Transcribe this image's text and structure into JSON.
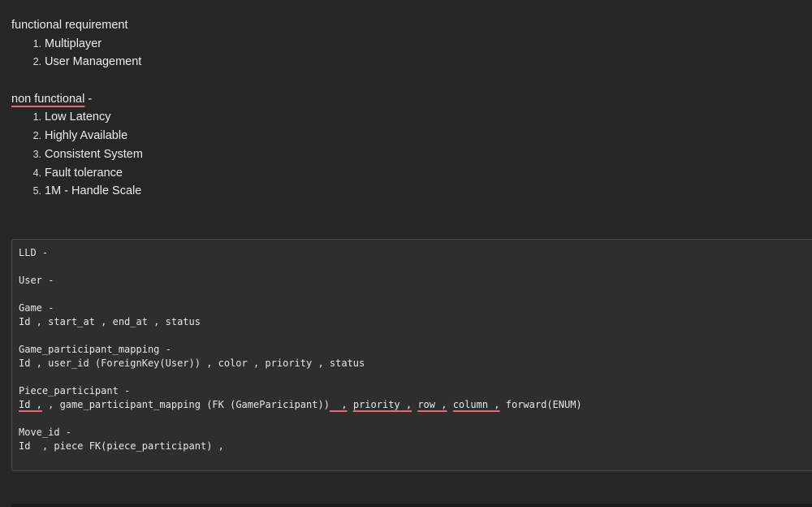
{
  "functional": {
    "heading": "functional requirement",
    "items": [
      "Multiplayer",
      "User Management"
    ]
  },
  "non_functional": {
    "heading_word": "non functional",
    "heading_suffix": " -",
    "items": [
      "Low Latency",
      "Highly Available",
      "Consistent System",
      "Fault tolerance",
      "1M - Handle Scale"
    ]
  },
  "numbers": [
    "1.",
    "2.",
    "3.",
    "4.",
    "5."
  ],
  "code": {
    "lld": "LLD -",
    "user": "User -",
    "game": "Game -",
    "game_fields": "Id , start_at , end_at , status",
    "gpm": "Game_participant_mapping -",
    "gpm_fields": "Id , user_id (ForeignKey(User)) , color , priority , status",
    "pp": "Piece_participant -",
    "pp_id": "Id",
    "pp_s1": " , game_participant_mapping (FK (GameParicipant))",
    "pp_gap1": "  ,",
    "pp_priority": "priority",
    "pp_c2": " ,",
    "pp_row": "row",
    "pp_c3": " ,",
    "pp_column": "column",
    "pp_c4": " ,",
    "pp_forward": " forward(ENUM)",
    "move": "Move_id -",
    "move_fields": "Id  , piece FK(piece_participant) ,"
  }
}
